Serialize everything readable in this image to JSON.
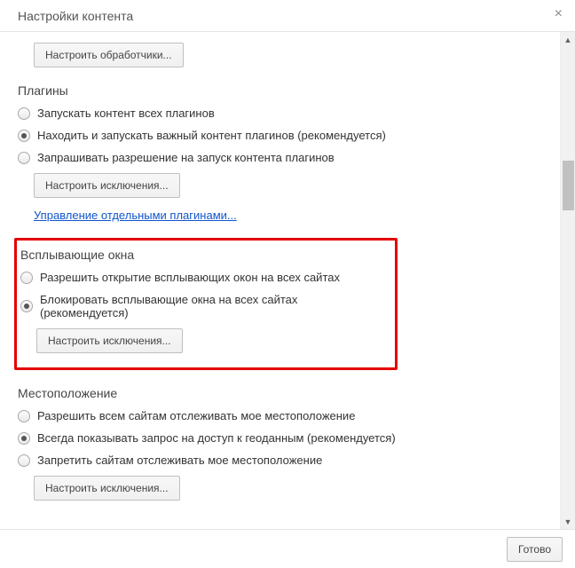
{
  "header": {
    "title": "Настройки контента"
  },
  "top": {
    "handlers_btn": "Настроить обработчики..."
  },
  "plugins": {
    "title": "Плагины",
    "opt_all": "Запускать контент всех плагинов",
    "opt_detect": "Находить и запускать важный контент плагинов (рекомендуется)",
    "opt_ask": "Запрашивать разрешение на запуск контента плагинов",
    "exceptions_btn": "Настроить исключения...",
    "manage_link": "Управление отдельными плагинами..."
  },
  "popups": {
    "title": "Всплывающие окна",
    "opt_allow": "Разрешить открытие всплывающих окон на всех сайтах",
    "opt_block": "Блокировать всплывающие окна на всех сайтах (рекомендуется)",
    "exceptions_btn": "Настроить исключения..."
  },
  "location": {
    "title": "Местоположение",
    "opt_allow": "Разрешить всем сайтам отслеживать мое местоположение",
    "opt_ask": "Всегда показывать запрос на доступ к геоданным (рекомендуется)",
    "opt_block": "Запретить сайтам отслеживать мое местоположение",
    "exceptions_btn": "Настроить исключения..."
  },
  "footer": {
    "done_btn": "Готово"
  }
}
